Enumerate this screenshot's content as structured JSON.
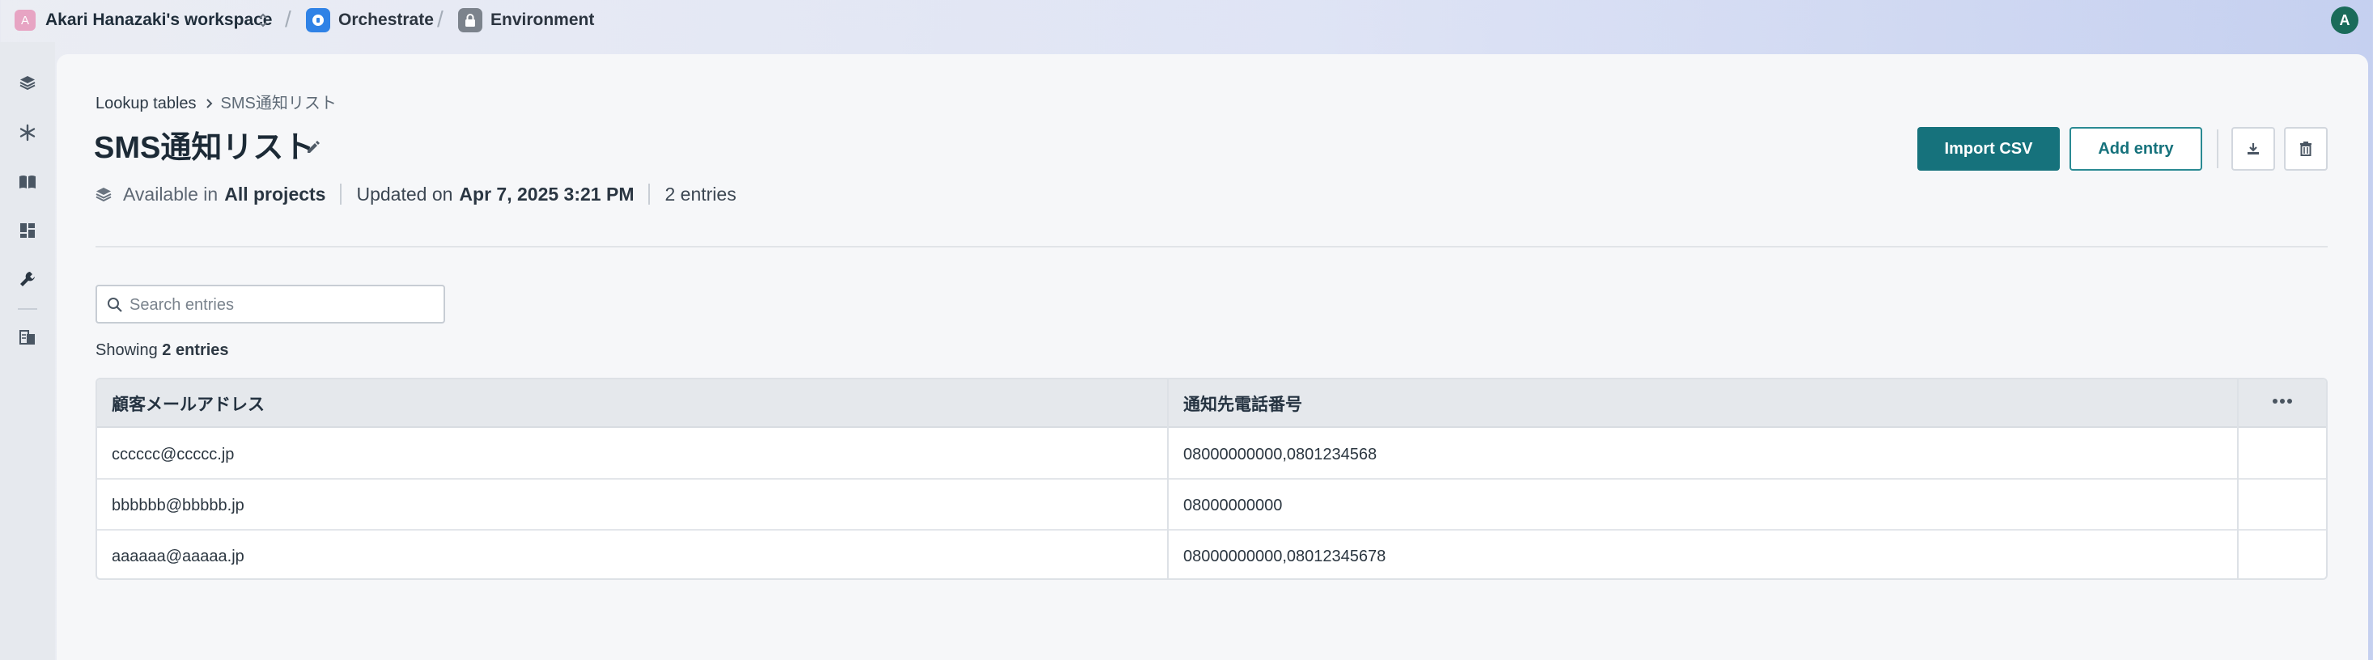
{
  "topbar": {
    "workspace_initial": "A",
    "workspace_name": "Akari Hanazaki's workspace",
    "separator": "/",
    "app_name": "Orchestrate",
    "env_name": "Environment",
    "user_initial": "A"
  },
  "sidebar": {
    "items": [
      {
        "icon": "layers-icon"
      },
      {
        "icon": "snowflake-icon"
      },
      {
        "icon": "book-icon"
      },
      {
        "icon": "dashboard-icon"
      },
      {
        "icon": "wrench-icon"
      },
      {
        "icon": "docs-icon"
      }
    ]
  },
  "breadcrumb": {
    "parent": "Lookup tables",
    "current": "SMS通知リスト"
  },
  "page": {
    "title": "SMS通知リスト",
    "available_prefix": "Available in",
    "available_value": "All projects",
    "updated_prefix": "Updated on",
    "updated_value": "Apr 7, 2025 3:21 PM",
    "entries_count": "2 entries"
  },
  "actions": {
    "import_label": "Import CSV",
    "add_label": "Add entry"
  },
  "search": {
    "placeholder": "Search entries"
  },
  "showing": {
    "prefix": "Showing",
    "count": "2 entries"
  },
  "table": {
    "columns": [
      "顧客メールアドレス",
      "通知先電話番号"
    ],
    "rows": [
      [
        "cccccc@ccccc.jp",
        "08000000000,0801234568"
      ],
      [
        "bbbbbb@bbbbb.jp",
        "08000000000"
      ],
      [
        "aaaaaa@aaaaa.jp",
        "08000000000,08012345678"
      ]
    ]
  },
  "colors": {
    "accent": "#16727c",
    "workspace_avatar": "#e7a4c3",
    "app_icon": "#2f82e6",
    "user_avatar": "#1a6b5a"
  }
}
